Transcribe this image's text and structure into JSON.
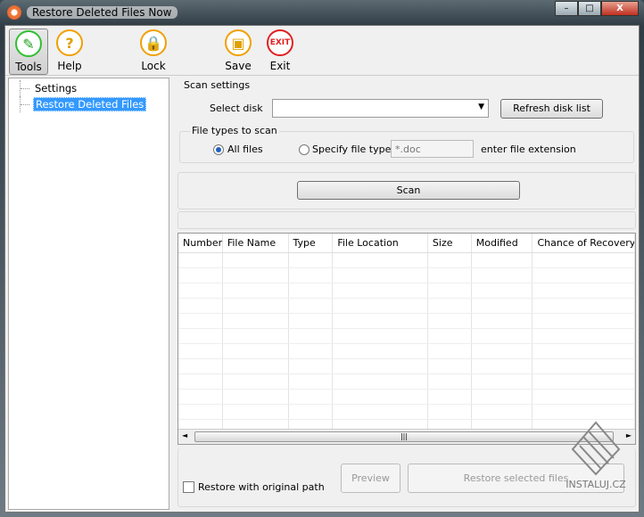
{
  "window": {
    "title": "Restore Deleted Files Now",
    "minimize": "–",
    "maximize": "□",
    "close": "X"
  },
  "toolbar": [
    {
      "label": "Tools",
      "icon": "pencil-icon"
    },
    {
      "label": "Help",
      "icon": "question-icon"
    },
    {
      "label": "Lock",
      "icon": "lock-icon"
    },
    {
      "label": "Save",
      "icon": "floppy-icon"
    },
    {
      "label": "Exit",
      "icon": "exit-icon",
      "icon_text": "EXIT"
    }
  ],
  "tree": {
    "items": [
      {
        "label": "Settings"
      },
      {
        "label": "Restore Deleted Files",
        "selected": true
      }
    ]
  },
  "scan_settings": {
    "title": "Scan settings",
    "select_disk_label": "Select disk",
    "disk_value": "",
    "refresh_button": "Refresh disk list",
    "file_types": {
      "title": "File types to scan",
      "all_files": "All files",
      "specify": "Specify file type",
      "extension_placeholder": "*.doc",
      "extension_hint": "enter file extension",
      "selected": "All files"
    }
  },
  "scan_button": "Scan",
  "table": {
    "columns": [
      "Number",
      "File Name",
      "Type",
      "File Location",
      "Size",
      "Modified",
      "Chance of Recovery"
    ],
    "rows": []
  },
  "footer": {
    "restore_original_path": "Restore with original path",
    "restore_original_path_checked": false,
    "preview_button": "Preview",
    "restore_button": "Restore selected files"
  },
  "watermark": "INSTALUJ.CZ"
}
